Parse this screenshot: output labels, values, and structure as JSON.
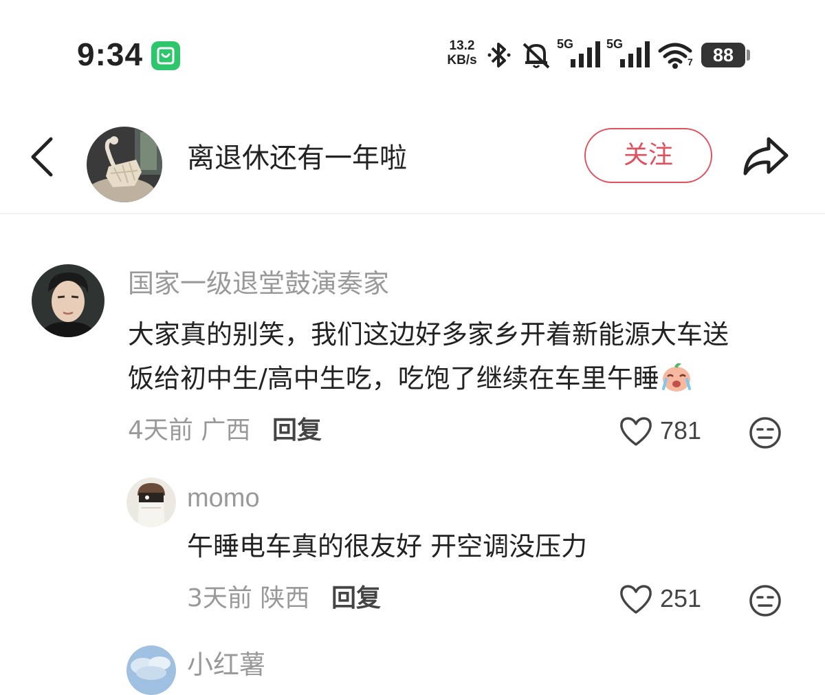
{
  "status_bar": {
    "time": "9:34",
    "net_speed_value": "13.2",
    "net_speed_unit": "KB/s",
    "network_1": "5G",
    "network_2": "5G",
    "wifi_sub": "7",
    "battery": "88",
    "icons": [
      "mi-home-icon",
      "bluetooth-icon",
      "mute-bell-icon",
      "signal-icon",
      "signal-icon",
      "wifi-icon",
      "battery-icon"
    ]
  },
  "header": {
    "title": "离退休还有一年啦",
    "follow_label": "关注",
    "accent": "#e0515f"
  },
  "comments": [
    {
      "username": "国家一级退堂鼓演奏家",
      "content_line1": "大家真的别笑，我们这边好多家乡开着新能源大车送",
      "content_line2": "饭给初中生/高中生吃，吃饱了继续在车里午睡",
      "time": "4天前",
      "location": "广西",
      "reply_label": "回复",
      "likes": "781"
    },
    {
      "username": "momo",
      "content": "午睡电车真的很友好 开空调没压力",
      "time": "3天前",
      "location": "陕西",
      "reply_label": "回复",
      "likes": "251"
    },
    {
      "username": "小红薯"
    }
  ]
}
